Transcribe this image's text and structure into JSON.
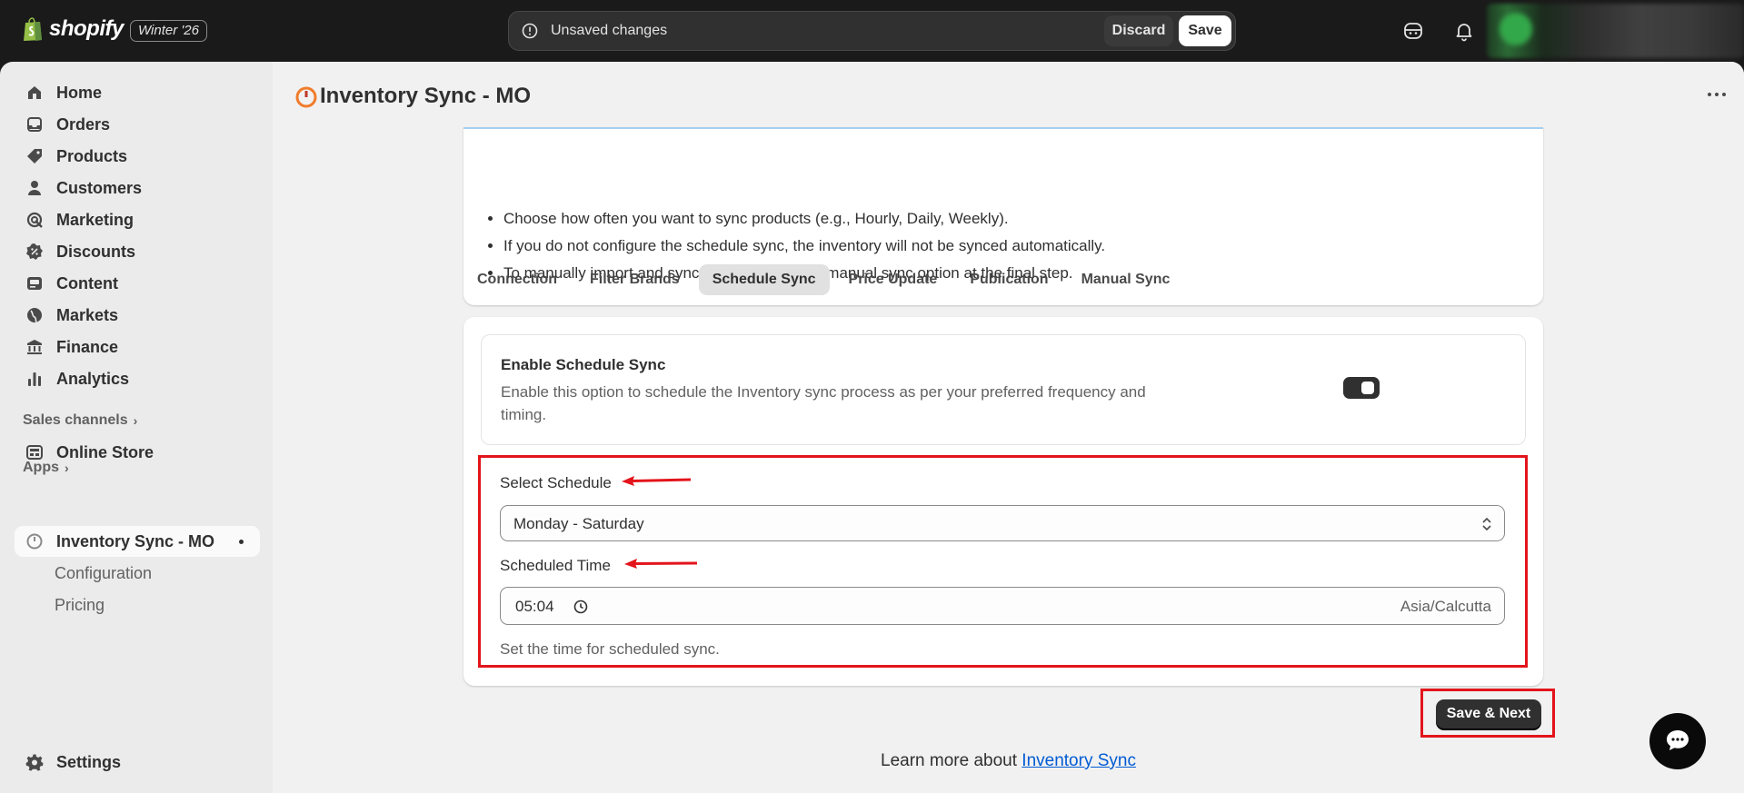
{
  "topbar": {
    "logo_text": "shopify",
    "edition": "Winter '26",
    "unsaved_text": "Unsaved changes",
    "discard_label": "Discard",
    "save_label": "Save"
  },
  "sidebar": {
    "items": [
      {
        "label": "Home",
        "icon": "home-icon"
      },
      {
        "label": "Orders",
        "icon": "orders-icon"
      },
      {
        "label": "Products",
        "icon": "tag-icon"
      },
      {
        "label": "Customers",
        "icon": "person-icon"
      },
      {
        "label": "Marketing",
        "icon": "marketing-icon"
      },
      {
        "label": "Discounts",
        "icon": "discount-icon"
      },
      {
        "label": "Content",
        "icon": "content-icon"
      },
      {
        "label": "Markets",
        "icon": "globe-icon"
      },
      {
        "label": "Finance",
        "icon": "bank-icon"
      },
      {
        "label": "Analytics",
        "icon": "bar-chart-icon"
      }
    ],
    "sales_channels_label": "Sales channels",
    "online_store_label": "Online Store",
    "apps_label": "Apps",
    "app_item_label": "Inventory Sync - MO",
    "app_sub_items": [
      "Configuration",
      "Pricing"
    ],
    "settings_label": "Settings"
  },
  "main": {
    "app_title": "Inventory Sync - MO",
    "info_bullets": [
      "Choose how often you want to sync products (e.g., Hourly, Daily, Weekly).",
      "If you do not configure the schedule sync, the inventory will not be synced automatically.",
      "To manually import and sync products, use the manual sync option at the final step."
    ],
    "tabs": [
      "Connection",
      "Filter Brands",
      "Schedule Sync",
      "Price Update",
      "Publication",
      "Manual Sync"
    ],
    "active_tab": "Schedule Sync",
    "enable": {
      "title": "Enable Schedule Sync",
      "description": "Enable this option to schedule the Inventory sync process as per your preferred frequency and timing.",
      "enabled": true
    },
    "schedule": {
      "select_label": "Select Schedule",
      "select_value": "Monday - Saturday",
      "time_label": "Scheduled Time",
      "time_value": "05:04",
      "timezone": "Asia/Calcutta",
      "help_text": "Set the time for scheduled sync."
    },
    "save_next_label": "Save & Next",
    "learn_prefix": "Learn more about",
    "learn_link": "Inventory Sync"
  },
  "colors": {
    "highlight": "#e3141b",
    "link": "#005bd3",
    "topbar_bg": "#1a1a1a"
  }
}
